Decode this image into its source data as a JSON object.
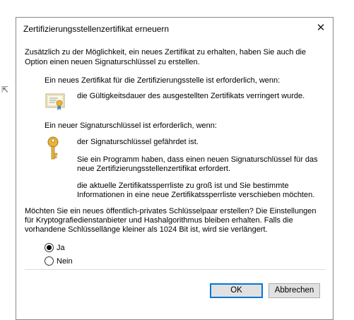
{
  "dialog": {
    "title": "Zertifizierungsstellenzertifikat erneuern",
    "close_glyph": "✕",
    "intro_line1": "Zusätzlich zu der Möglichkeit, ein neues Zertifikat zu erhalten, haben Sie auch die",
    "intro_line2": "Option einen neuen Signaturschlüssel zu erstellen.",
    "cert_heading": "Ein neues Zertifikat für die Zertifizierungsstelle ist erforderlich, wenn:",
    "cert_reason": "die Gültigkeitsdauer des ausgestellten Zertifikats verringert wurde.",
    "key_heading": "Ein neuer Signaturschlüssel ist erforderlich, wenn:",
    "key_reason1": "der Signaturschlüssel gefährdet ist.",
    "key_reason2_line1": "Sie ein Programm haben, dass einen neuen Signaturschlüssel für das",
    "key_reason2_line2": "neue Zertifizierungsstellenzertifikat erfordert.",
    "key_reason3_line1": "die aktuelle Zertifikatssperrliste zu groß ist und Sie bestimmte",
    "key_reason3_line2": "Informationen in eine neue Zertifikatssperrliste verschieben möchten.",
    "question_line1": "Möchten Sie ein neues öffentlich-privates Schlüsselpaar erstellen? Die Einstellungen",
    "question_line2": "für Kryptografiedienstanbieter und Hashalgorithmus bleiben erhalten. Falls die",
    "question_line3": "vorhandene Schlüssellänge kleiner als 1024 Bit ist, wird sie verlängert.",
    "options": [
      {
        "label": "Ja",
        "selected": true
      },
      {
        "label": "Nein",
        "selected": false
      }
    ],
    "ok_label": "OK",
    "cancel_label": "Abbrechen"
  },
  "icons": {
    "certificate": "certificate-icon",
    "key": "key-icon"
  },
  "colors": {
    "default_button_border": "#0078d7",
    "button_face": "#e1e1e1",
    "key_gold": "#e8b43a",
    "cert_ribbon": "#4a86c5"
  }
}
